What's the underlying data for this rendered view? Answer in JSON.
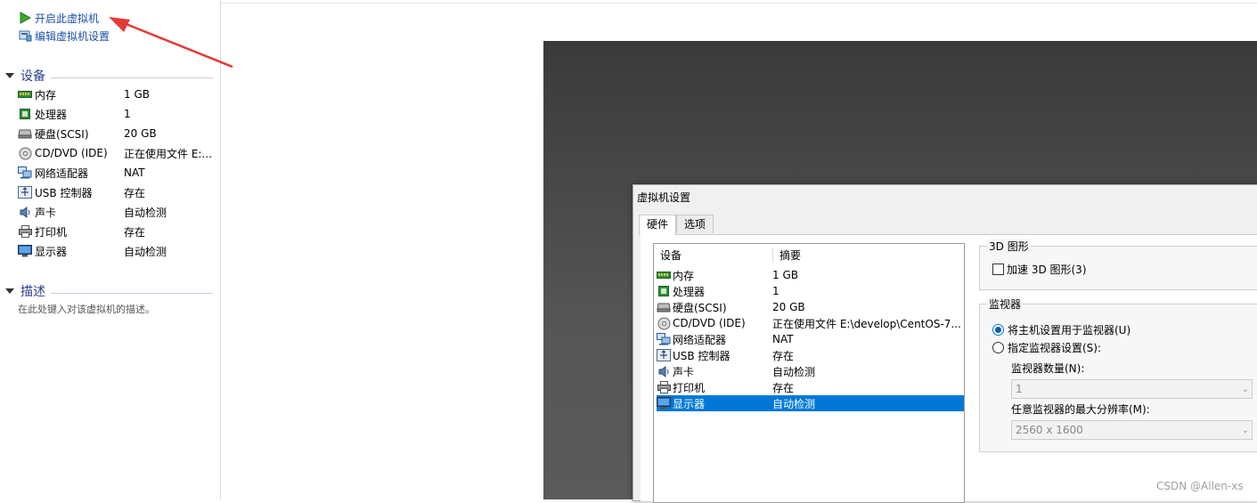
{
  "actions": {
    "power_on": "开启此虚拟机",
    "edit_settings": "编辑虚拟机设置"
  },
  "sections": {
    "devices_title": "设备",
    "description_title": "描述",
    "description_placeholder": "在此处键入对该虚拟机的描述。"
  },
  "devices": [
    {
      "icon": "memory-icon",
      "name": "内存",
      "value": "1 GB"
    },
    {
      "icon": "processor-icon",
      "name": "处理器",
      "value": "1"
    },
    {
      "icon": "hard-disk-icon",
      "name": "硬盘(SCSI)",
      "value": "20 GB"
    },
    {
      "icon": "cd-dvd-icon",
      "name": "CD/DVD (IDE)",
      "value": "正在使用文件 E:..."
    },
    {
      "icon": "network-adapter-icon",
      "name": "网络适配器",
      "value": "NAT"
    },
    {
      "icon": "usb-controller-icon",
      "name": "USB 控制器",
      "value": "存在"
    },
    {
      "icon": "sound-card-icon",
      "name": "声卡",
      "value": "自动检测"
    },
    {
      "icon": "printer-icon",
      "name": "打印机",
      "value": "存在"
    },
    {
      "icon": "display-icon",
      "name": "显示器",
      "value": "自动检测"
    }
  ],
  "dialog": {
    "title": "虚拟机设置",
    "tabs": [
      "硬件",
      "选项"
    ],
    "list_header": {
      "device": "设备",
      "summary": "摘要"
    },
    "items": [
      {
        "icon": "memory-icon",
        "name": "内存",
        "value": "1 GB"
      },
      {
        "icon": "processor-icon",
        "name": "处理器",
        "value": "1"
      },
      {
        "icon": "hard-disk-icon",
        "name": "硬盘(SCSI)",
        "value": "20 GB"
      },
      {
        "icon": "cd-dvd-icon",
        "name": "CD/DVD (IDE)",
        "value": "正在使用文件 E:\\develop\\CentOS-7..."
      },
      {
        "icon": "network-adapter-icon",
        "name": "网络适配器",
        "value": "NAT"
      },
      {
        "icon": "usb-controller-icon",
        "name": "USB 控制器",
        "value": "存在"
      },
      {
        "icon": "sound-card-icon",
        "name": "声卡",
        "value": "自动检测"
      },
      {
        "icon": "printer-icon",
        "name": "打印机",
        "value": "存在"
      },
      {
        "icon": "display-icon",
        "name": "显示器",
        "value": "自动检测"
      }
    ],
    "selected_item": "显示器",
    "graphics_group": {
      "title": "3D 图形",
      "accelerate_label": "加速 3D 图形(3)",
      "accelerate_checked": false
    },
    "monitor_group": {
      "title": "监视器",
      "use_host_label": "将主机设置用于监视器(U)",
      "specify_label": "指定监视器设置(S):",
      "selected_option": "use_host",
      "count_label": "监视器数量(N):",
      "count_value": "1",
      "max_res_label": "任意监视器的最大分辨率(M):",
      "max_res_value": "2560 x 1600"
    }
  },
  "watermark": "CSDN @Allen-xs",
  "colors": {
    "selection": "#0078d7",
    "link": "#1e4fa8",
    "arrow": "#e53935",
    "section_title": "#2b3f8a"
  }
}
